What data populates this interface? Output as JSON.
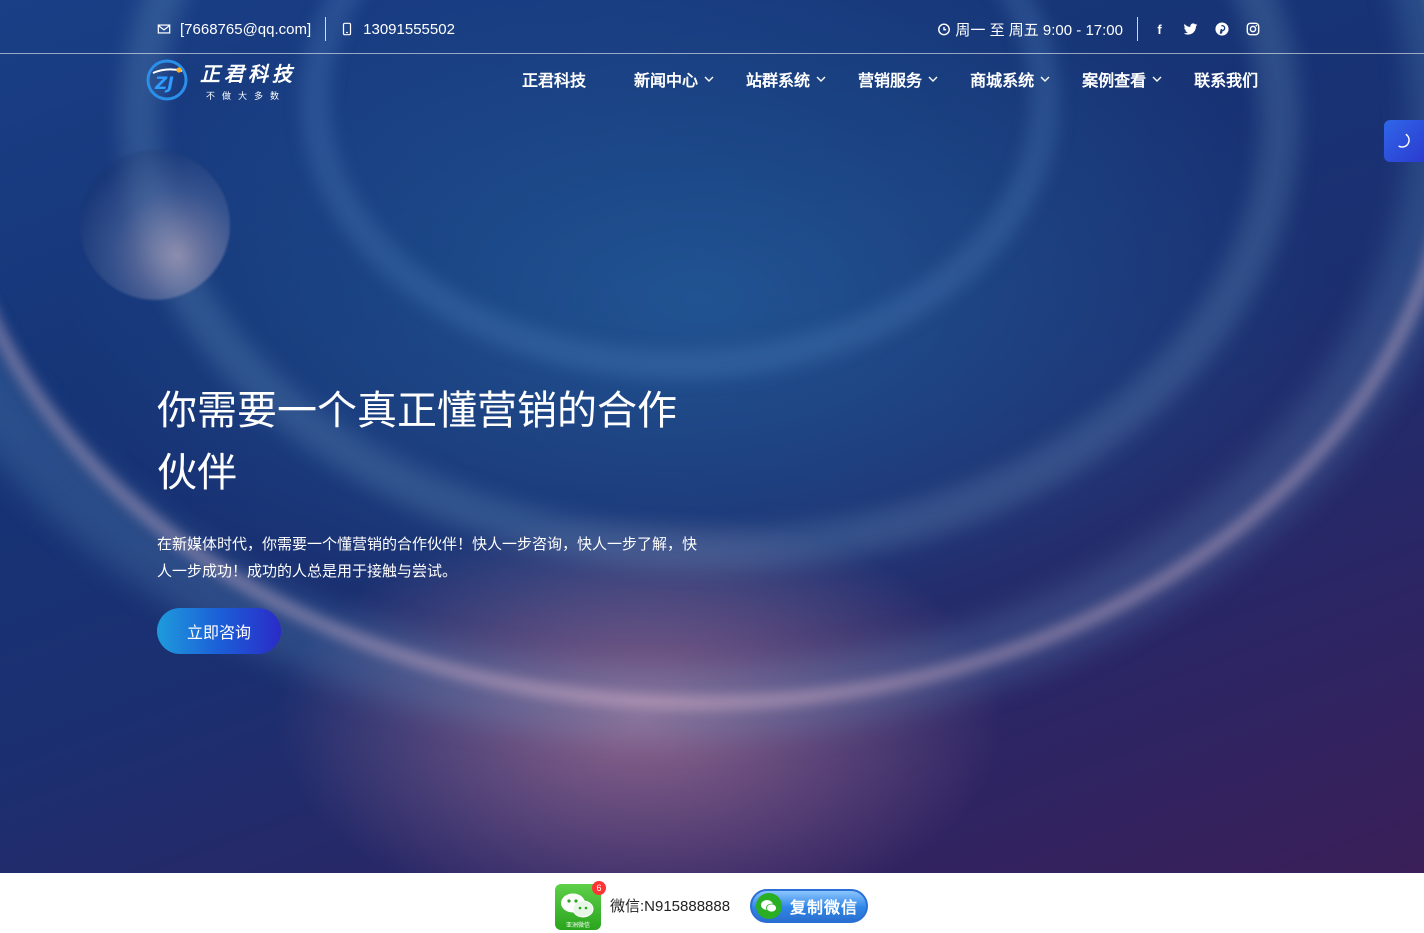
{
  "topbar": {
    "email": "[7668765@qq.com]",
    "phone": "13091555502",
    "hours": "周一 至 周五 9:00 - 17:00",
    "social": [
      "facebook-icon",
      "twitter-icon",
      "pinterest-icon",
      "instagram-icon"
    ]
  },
  "logo": {
    "name": "正君科技",
    "slogan": "不做大多数",
    "mark": "ZJ"
  },
  "nav": {
    "items": [
      {
        "label": "正君科技",
        "dropdown": false
      },
      {
        "label": "新闻中心",
        "dropdown": true
      },
      {
        "label": "站群系统",
        "dropdown": true
      },
      {
        "label": "营销服务",
        "dropdown": true
      },
      {
        "label": "商城系统",
        "dropdown": true
      },
      {
        "label": "案例查看",
        "dropdown": true
      },
      {
        "label": "联系我们",
        "dropdown": false
      }
    ]
  },
  "hero": {
    "title_line1": "你需要一个真正懂营销的合作",
    "title_line2": "伙伴",
    "description": "在新媒体时代，你需要一个懂营销的合作伙伴！快人一步咨询，快人一步了解，快人一步成功！成功的人总是用于接触与尝试。",
    "cta_label": "立即咨询"
  },
  "wechat": {
    "badge": "6",
    "app_caption": "亚洲微信",
    "label": "微信:N915888888",
    "copy_label": "复制微信"
  },
  "colors": {
    "accent": "#2f66e8",
    "cta_start": "#1e9bdc",
    "cta_end": "#2a2bc7",
    "badge": "#ff3333"
  }
}
